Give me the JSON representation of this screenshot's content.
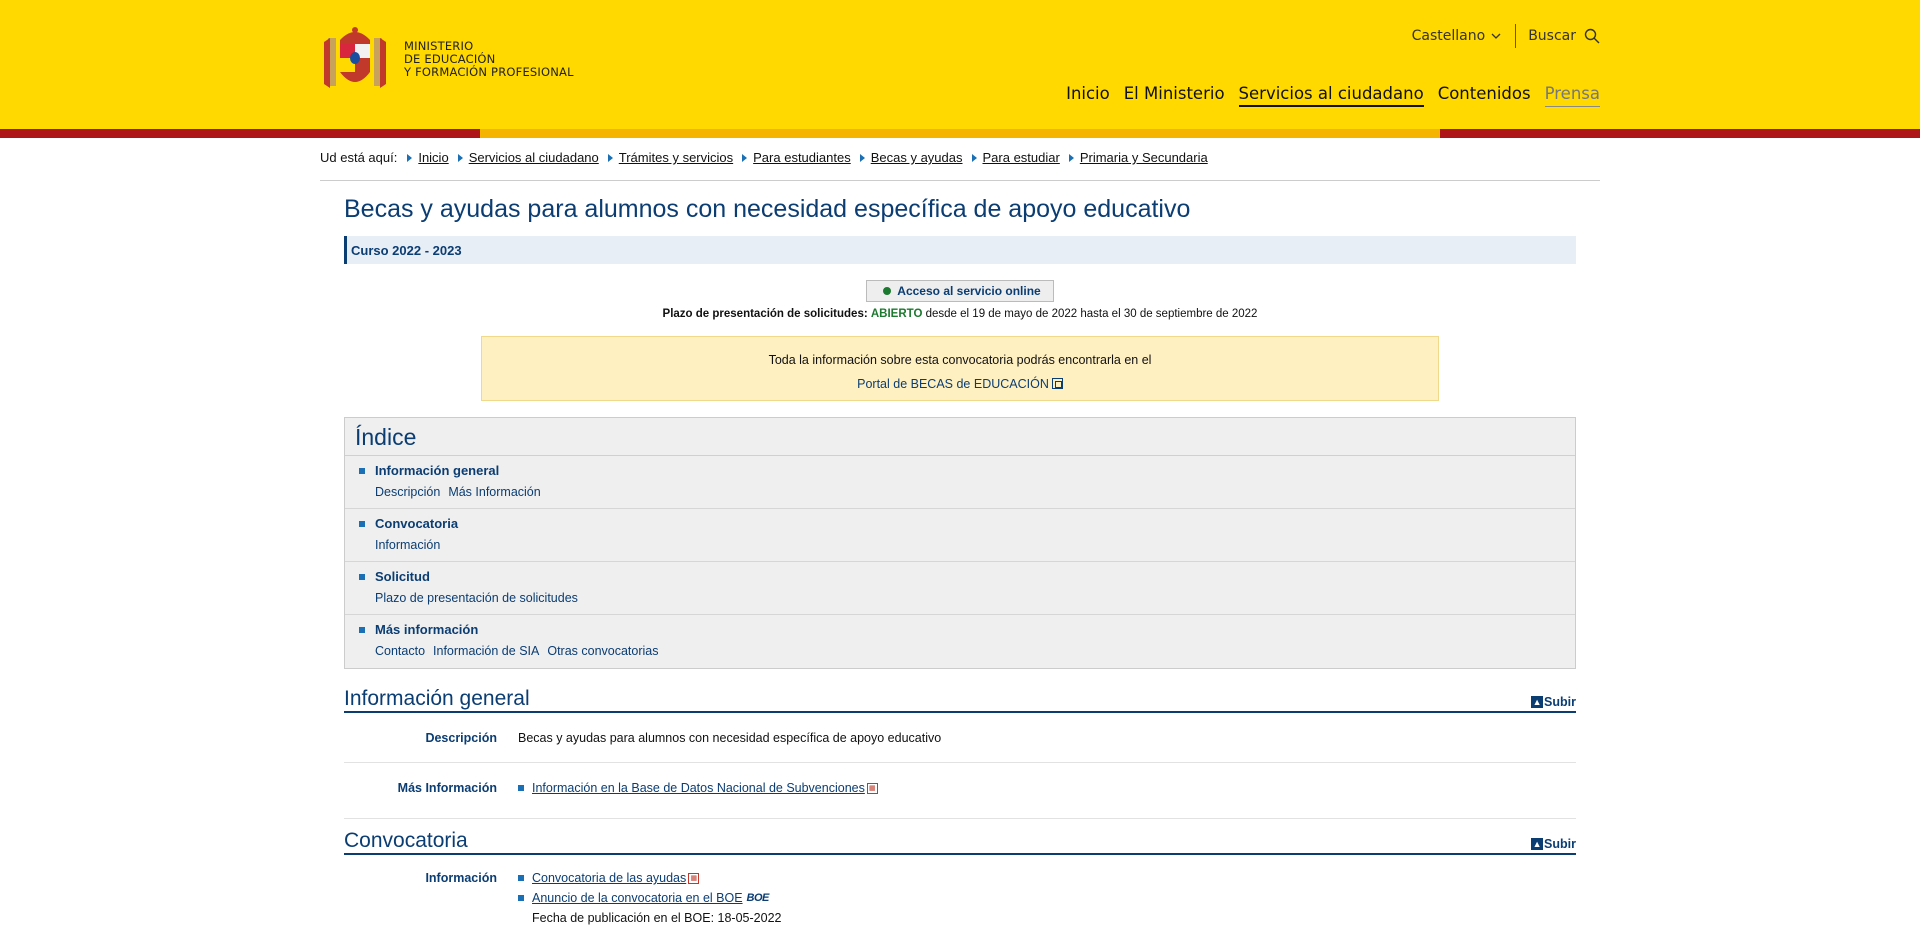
{
  "header": {
    "logo_lines": [
      "MINISTERIO",
      "DE EDUCACIÓN",
      "Y FORMACIÓN PROFESIONAL"
    ],
    "language": "Castellano",
    "search_label": "Buscar",
    "nav": [
      "Inicio",
      "El Ministerio",
      "Servicios al ciudadano",
      "Contenidos",
      "Prensa"
    ]
  },
  "breadcrumb": {
    "label": "Ud está aquí:",
    "items": [
      "Inicio",
      "Servicios al ciudadano",
      "Trámites y servicios",
      "Para estudiantes",
      "Becas y ayudas",
      "Para estudiar",
      "Primaria y Secundaria"
    ]
  },
  "page": {
    "title": "Becas y ayudas para alumnos con necesidad específica de apoyo educativo",
    "curso": "Curso 2022 - 2023",
    "online_button": "Acceso al servicio online",
    "plazo_label": "Plazo de presentación de solicitudes:",
    "plazo_status": "ABIERTO",
    "plazo_range": "desde el 19 de mayo de 2022 hasta el 30 de septiembre de 2022",
    "notice_text": "Toda la información sobre esta convocatoria podrás encontrarla en el",
    "notice_link": "Portal de BECAS de EDUCACIÓN"
  },
  "indice": {
    "title": "Índice",
    "sections": [
      {
        "title": "Información general",
        "links": [
          "Descripción",
          "Más Información"
        ]
      },
      {
        "title": "Convocatoria",
        "links": [
          "Información"
        ]
      },
      {
        "title": "Solicitud",
        "links": [
          "Plazo de presentación de solicitudes"
        ]
      },
      {
        "title": "Más información",
        "links": [
          "Contacto",
          "Información de SIA",
          "Otras convocatorias"
        ]
      }
    ]
  },
  "info_general": {
    "title": "Información general",
    "subir": "Subir",
    "descripcion_label": "Descripción",
    "descripcion_value": "Becas y ayudas para alumnos con necesidad específica de apoyo educativo",
    "mas_info_label": "Más Información",
    "mas_info_link": "Información en la Base de Datos Nacional de Subvenciones"
  },
  "convocatoria": {
    "title": "Convocatoria",
    "subir": "Subir",
    "info_label": "Información",
    "link_1": "Convocatoria de las ayudas",
    "link_2": "Anuncio de la convocatoria en el BOE",
    "boe_badge": "BOE",
    "fecha": "Fecha de publicación en el BOE: 18-05-2022"
  }
}
